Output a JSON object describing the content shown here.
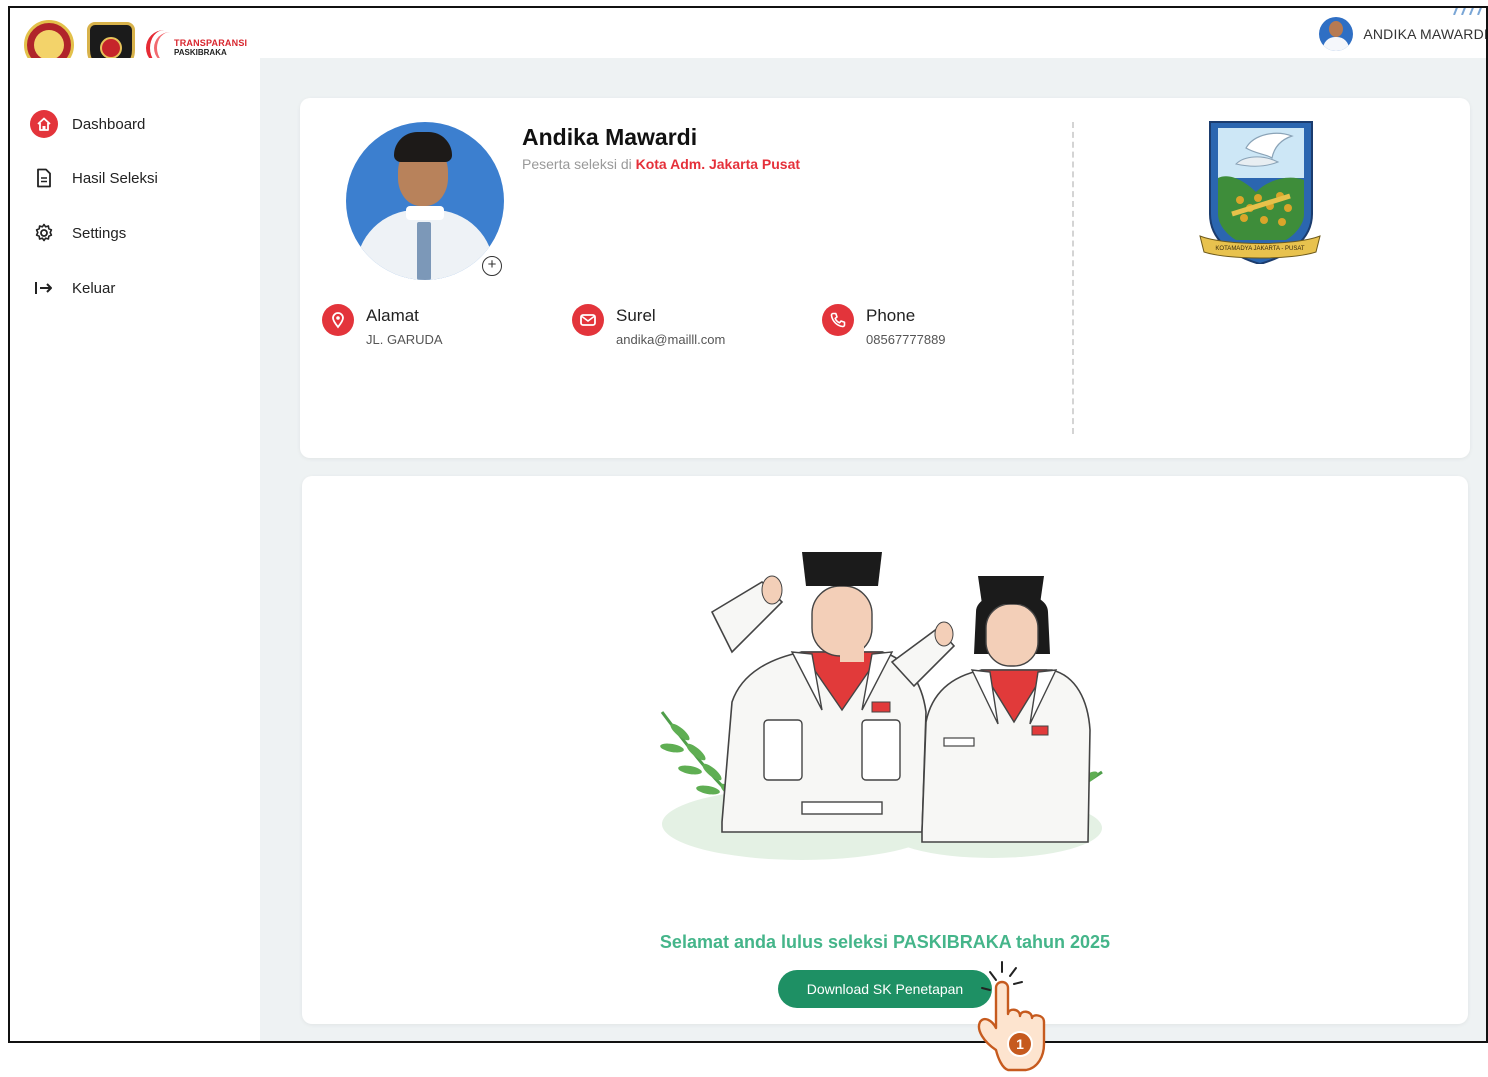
{
  "brand": {
    "logo_text_line1": "TRANSPARANSI",
    "logo_text_line2": "PASKIBRAKA"
  },
  "header": {
    "user_name": "ANDIKA MAWARDI"
  },
  "sidebar": {
    "items": [
      {
        "label": "Dashboard",
        "icon": "home-icon",
        "active": true
      },
      {
        "label": "Hasil Seleksi",
        "icon": "document-icon",
        "active": false
      },
      {
        "label": "Settings",
        "icon": "gear-icon",
        "active": false
      },
      {
        "label": "Keluar",
        "icon": "logout-icon",
        "active": false
      }
    ]
  },
  "profile": {
    "name": "Andika Mawardi",
    "subtitle_prefix": "Peserta seleksi di",
    "city": "Kota Adm. Jakarta Pusat",
    "info": [
      {
        "label": "Alamat",
        "value": "JL. GARUDA",
        "icon": "location-pin-icon"
      },
      {
        "label": "Surel",
        "value": "andika@mailll.com",
        "icon": "mail-icon"
      },
      {
        "label": "Phone",
        "value": "08567777889",
        "icon": "phone-icon"
      }
    ],
    "emblem_caption": "KOTAMADYA JAKARTA - PUSAT"
  },
  "result": {
    "message": "Selamat anda lulus seleksi PASKIBRAKA tahun 2025",
    "download_label": "Download SK Penetapan"
  },
  "annotation": {
    "step_number": "1"
  },
  "colors": {
    "accent_red": "#e3343b",
    "success_green": "#45b58a",
    "button_green": "#1e9064",
    "background": "#eef2f3"
  }
}
